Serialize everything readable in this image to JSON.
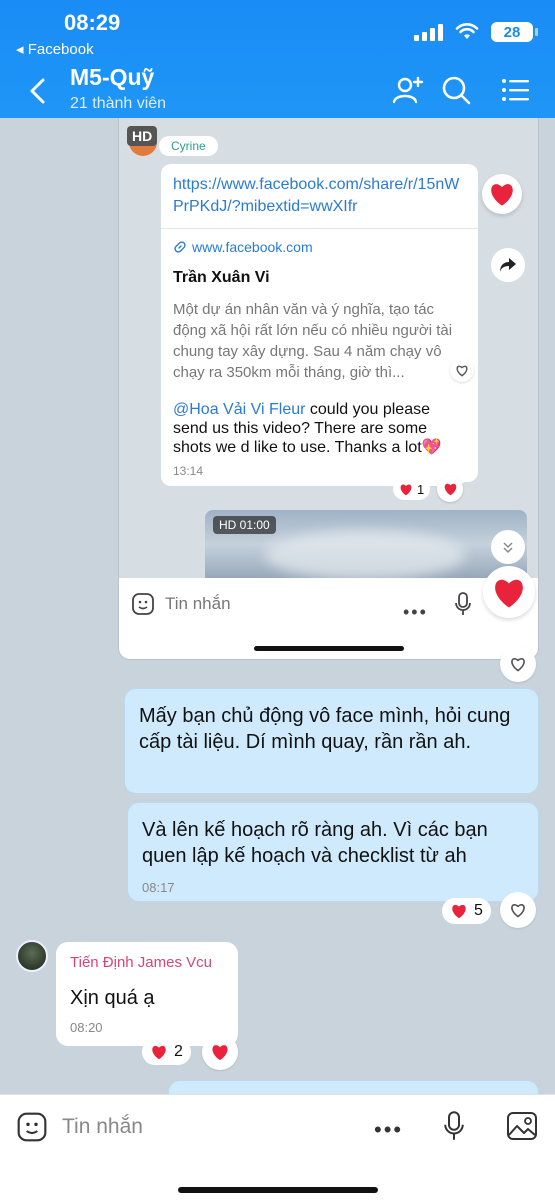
{
  "status": {
    "time": "08:29",
    "back_app": "◂ Facebook",
    "battery": "28"
  },
  "header": {
    "title": "M5-Quỹ",
    "subtitle": "21 thành viên"
  },
  "nested": {
    "hd": "HD",
    "sender": "Cyrine",
    "link_url": "https://www.facebook.com/share/r/15nWPrPKdJ/?mibextid=wwXIfr",
    "link_domain": "www.facebook.com",
    "link_title": "Trần Xuân Vi",
    "link_desc": "Một dự án nhân văn và ý nghĩa, tạo tác động xã hội rất lớn nếu có nhiều người tài chung tay xây dựng. Sau 4 năm chạy vô chạy ra 350km mỗi tháng, giờ thì...",
    "msg_mention": "@Hoa Vải Vi Fleur",
    "msg_text": " could you please send us this video? There are some shots we d like to use. Thanks a lot💖",
    "msg_time": "13:14",
    "msg_react_count": "1",
    "video_badge": "HD  01:00",
    "input_placeholder": "Tin nhắn"
  },
  "messages": {
    "out1": "Mấy bạn chủ động vô face mình, hỏi cung cấp tài liệu. Dí mình quay, rần rần ah.",
    "out2": "Và lên kế hoạch rõ ràng ah. Vì các bạn quen lập kế hoạch và checklist từ ah",
    "out2_time": "08:17",
    "out2_react_count": "5",
    "in1_sender": "Tiến Định James Vcu",
    "in1_text": "Xịn quá ạ",
    "in1_time": "08:20",
    "in1_react_count": "2"
  },
  "input": {
    "placeholder": "Tin nhắn"
  },
  "colors": {
    "header": "#1a8cf6",
    "outgoing_bubble": "#cfeafd",
    "heart": "#e8233b",
    "sender_name": "#d6457a"
  }
}
